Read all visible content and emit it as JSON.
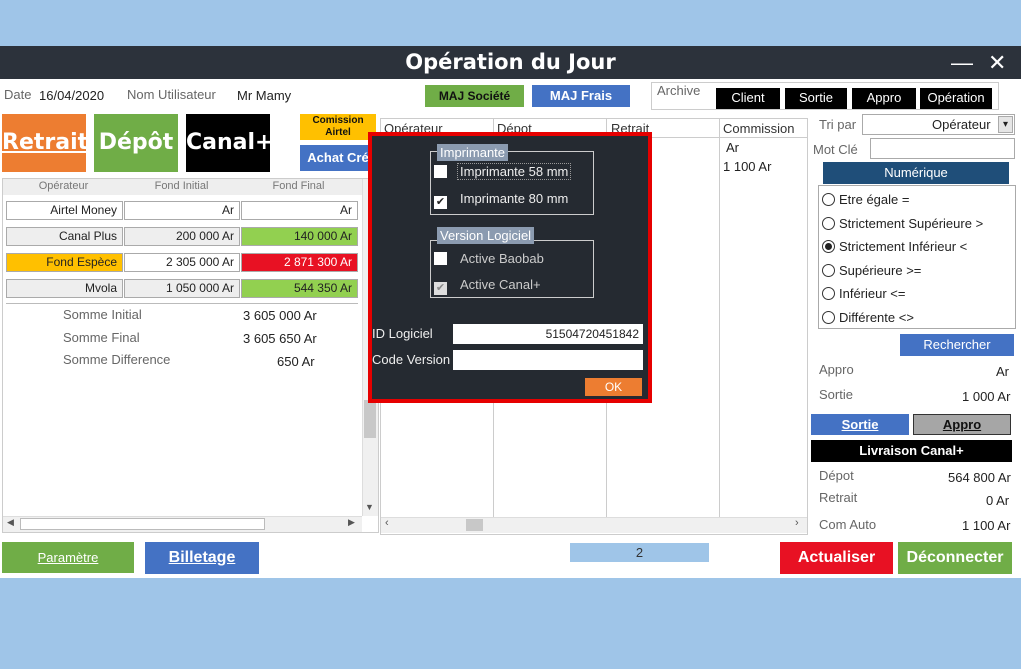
{
  "window": {
    "title": "Opération du Jour",
    "minimize": "—",
    "close": "✕"
  },
  "header": {
    "date_label": "Date",
    "date_value": "16/04/2020",
    "user_label": "Nom Utilisateur",
    "user_value": "Mr Mamy",
    "maj_societe": "MAJ Société",
    "maj_frais": "MAJ Frais",
    "archive_label": "Archive",
    "archive_tabs": [
      "Client",
      "Sortie",
      "Appro",
      "Opération"
    ]
  },
  "actions": {
    "retrait": "Retrait",
    "depot": "Dépôt",
    "canal": "Canal+",
    "commission": "Comission Airtel",
    "achat": "Achat Cré"
  },
  "fonds": {
    "headers": [
      "Opérateur",
      "Fond Initial",
      "Fond Final"
    ],
    "rows": [
      {
        "op": "Airtel Money",
        "init": "Ar",
        "final": "Ar"
      },
      {
        "op": "Canal Plus",
        "init": "200 000 Ar",
        "final": "140 000 Ar"
      },
      {
        "op": "Fond Espèce",
        "init": "2 305 000 Ar",
        "final": "2 871 300 Ar"
      },
      {
        "op": "Mvola",
        "init": "1 050 000 Ar",
        "final": "544 350 Ar"
      }
    ],
    "somme_initial_label": "Somme Initial",
    "somme_initial": "3 605 000 Ar",
    "somme_final_label": "Somme Final",
    "somme_final": "3 605 650 Ar",
    "somme_diff_label": "Somme Difference",
    "somme_diff": "650 Ar"
  },
  "table": {
    "headers": [
      "Opérateur",
      "Dépot",
      "Retrait",
      "Commission"
    ],
    "commission_values": [
      "Ar",
      "1 100 Ar"
    ]
  },
  "filter": {
    "tri_label": "Tri par",
    "tri_value": "Opérateur",
    "motcle_label": "Mot Clé",
    "numeric_label": "Numérique",
    "options": [
      "Etre égale =",
      "Strictement Supérieure >",
      "Strictement Inférieur <",
      "Supérieure >=",
      "Inférieur <=",
      "Différente <>"
    ],
    "selected": 2,
    "search": "Rechercher",
    "appro_label": "Appro",
    "appro_value": "Ar",
    "sortie_label": "Sortie",
    "sortie_value": "1 000 Ar",
    "sortie_btn": "Sortie",
    "appro_btn": "Appro",
    "livraison": "Livraison Canal+",
    "depot_label": "Dépot",
    "depot_value": "564 800 Ar",
    "retrait_label": "Retrait",
    "retrait_value": "0 Ar",
    "comauto_label": "Com Auto",
    "comauto_value": "1 100 Ar"
  },
  "footer": {
    "parametre": "Paramètre",
    "billetage": "Billetage",
    "page": "2",
    "actualiser": "Actualiser",
    "deconnecter": "Déconnecter"
  },
  "dialog": {
    "printer_group": "Imprimante",
    "printer_58": "Imprimante 58 mm",
    "printer_80": "Imprimante 80 mm",
    "version_group": "Version Logiciel",
    "baobab": "Active Baobab",
    "canal": "Active Canal+",
    "id_label": "ID Logiciel",
    "id_value": "51504720451842",
    "code_label": "Code Version",
    "code_value": "",
    "ok": "OK"
  },
  "colors": {
    "green": "#70ad47",
    "orange": "#ed7d31",
    "red": "#e81123",
    "blue": "#4472c4",
    "dark": "#2c323b"
  }
}
